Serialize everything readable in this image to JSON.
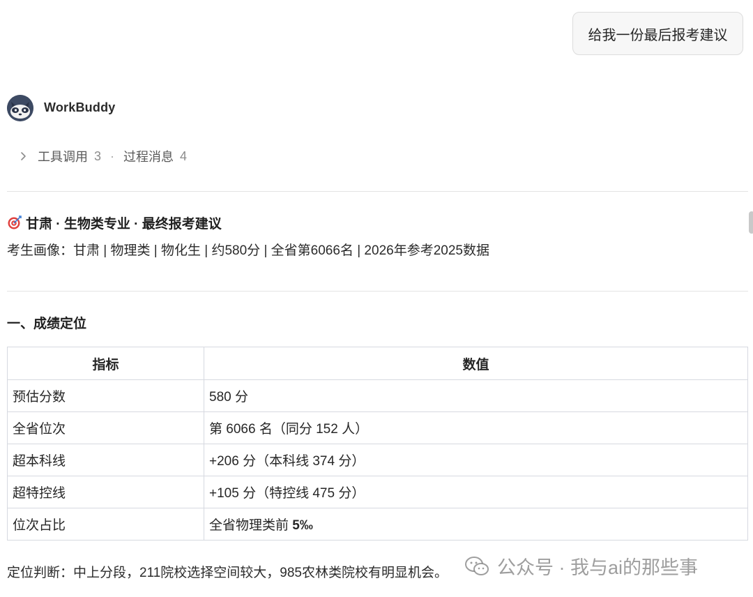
{
  "user_message": "给我一份最后报考建议",
  "assistant": {
    "name": "WorkBuddy",
    "avatar_icon": "raccoon-avatar-icon"
  },
  "process": {
    "tools_label": "工具调用",
    "tools_count": "3",
    "separator": "·",
    "messages_label": "过程消息",
    "messages_count": "4"
  },
  "report": {
    "title_icon": "target-icon",
    "title": "甘肃 · 生物类专业 · 最终报考建议",
    "profile": "考生画像：甘肃 | 物理类 | 物化生 | 约580分 | 全省第6066名 | 2026年参考2025数据",
    "section1_title": "一、成绩定位",
    "table": {
      "headers": [
        "指标",
        "数值"
      ],
      "rows": [
        {
          "label": "预估分数",
          "value": "580 分"
        },
        {
          "label": "全省位次",
          "value": "第 6066 名（同分 152 人）"
        },
        {
          "label": "超本科线",
          "value": "+206 分（本科线 374 分）"
        },
        {
          "label": "超特控线",
          "value": "+105 分（特控线 475 分）"
        },
        {
          "label": "位次占比",
          "value_prefix": "全省物理类前 ",
          "value_bold": "5‰"
        }
      ]
    },
    "conclusion": "定位判断：中上分段，211院校选择空间较大，985农林类院校有明显机会。"
  },
  "watermark": {
    "text": "公众号 · 我与ai的那些事",
    "icon": "wechat-icon"
  },
  "colors": {
    "border": "#d6d9e0",
    "divider": "#e3e3e3",
    "bubble_bg": "#f7f7f7",
    "avatar_bg": "#3d4a63"
  }
}
